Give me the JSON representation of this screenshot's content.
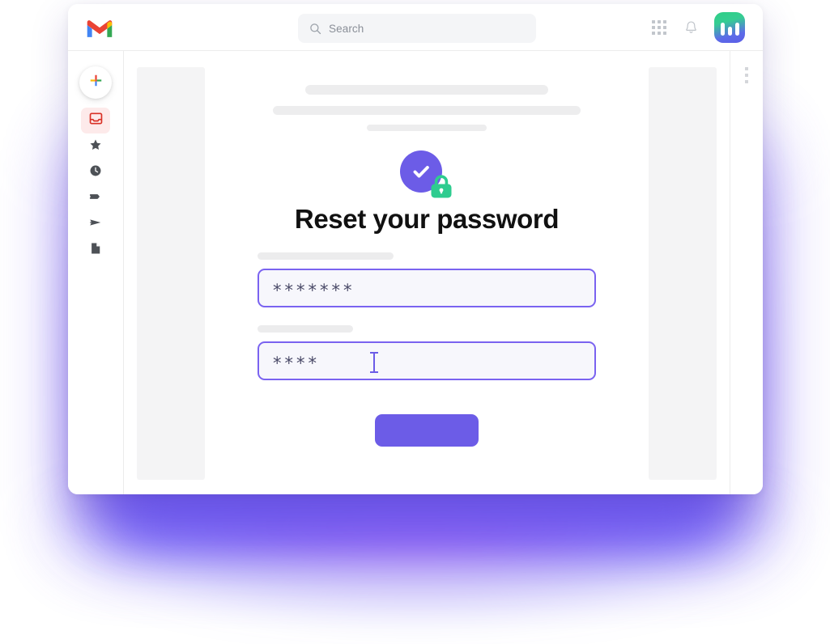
{
  "window": {
    "title": "Gmail"
  },
  "header": {
    "logo_icon": "gmail-logo-icon",
    "search": {
      "icon": "search-icon",
      "text": "Search",
      "placeholder": "Search"
    },
    "apps_icon": "apps-grid-icon",
    "notifications_icon": "bell-icon",
    "brand_icon": "brand-logo-icon"
  },
  "sidebar": {
    "compose": {
      "icon": "plus-icon",
      "label": "Compose"
    },
    "items": [
      {
        "icon": "inbox-icon",
        "label": "Inbox",
        "active": true
      },
      {
        "icon": "star-icon",
        "label": "Starred",
        "active": false
      },
      {
        "icon": "clock-icon",
        "label": "Snoozed",
        "active": false
      },
      {
        "icon": "label-icon",
        "label": "Important",
        "active": false
      },
      {
        "icon": "send-icon",
        "label": "Sent",
        "active": false
      },
      {
        "icon": "drafts-icon",
        "label": "Drafts",
        "active": false
      }
    ]
  },
  "main": {
    "skeleton_lines": [
      "",
      "",
      ""
    ],
    "hero_icon": {
      "check_icon": "check-circle-icon",
      "lock_icon": "lock-icon",
      "circle_color": "#6c5ce7",
      "lock_color": "#2ecc8f"
    },
    "title": "Reset your password",
    "form": {
      "password_field": {
        "name": "new-password",
        "value": "*******",
        "masked_char_count": 7,
        "focused": false
      },
      "confirm_field": {
        "name": "confirm-password",
        "value": "****",
        "masked_char_count": 4,
        "focused": true,
        "caret_icon": "text-caret-icon"
      },
      "submit": {
        "label": "",
        "color": "#6c5ce7"
      }
    },
    "overflow_menu_icon": "kebab-menu-icon"
  },
  "colors": {
    "accent": "#6c5ce7",
    "field_border": "#7a63f0",
    "field_fill": "#f7f7fc",
    "skeleton": "#ededee",
    "glow": "#7c62f6",
    "inbox_active_bg": "#fdeaea",
    "inbox_icon": "#d93025"
  }
}
